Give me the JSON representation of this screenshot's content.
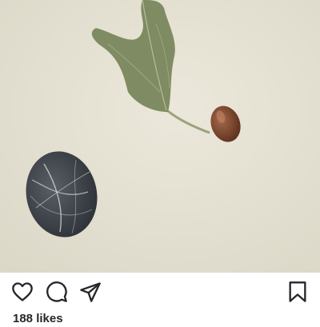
{
  "post": {
    "image_description_icon": "photo",
    "likes_text": "188 likes"
  },
  "actions": {
    "like_icon": "heart-icon",
    "comment_icon": "comment-icon",
    "share_icon": "share-icon",
    "save_icon": "bookmark-icon"
  },
  "colors": {
    "icon": "#262626",
    "background": "#ffffff",
    "photo_background": "#e8e4d6"
  }
}
